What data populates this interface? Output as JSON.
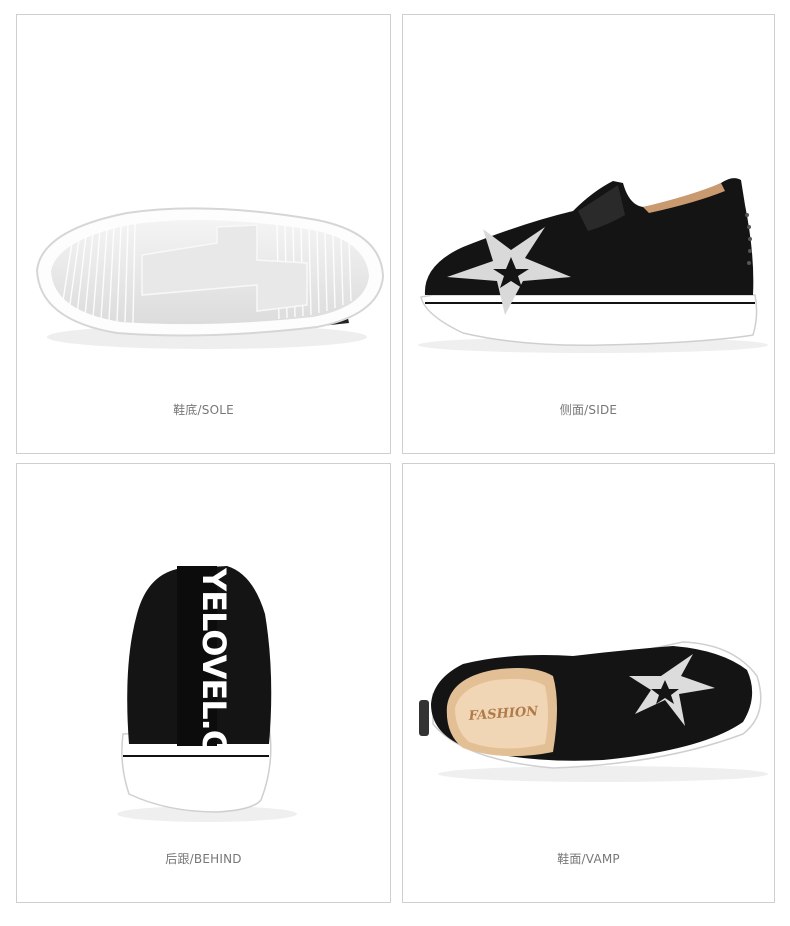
{
  "panels": [
    {
      "caption": "鞋底/SOLE",
      "view": "sole"
    },
    {
      "caption": "侧面/SIDE",
      "view": "side"
    },
    {
      "caption": "后跟/BEHIND",
      "view": "behind"
    },
    {
      "caption": "鞋面/VAMP",
      "view": "vamp"
    }
  ],
  "heel_text": "YELOVEL.C",
  "insole_text": "FASHION",
  "colors": {
    "upper": "#111111",
    "sole": "#ffffff",
    "star": "#d9d9d9",
    "border": "#cfcfcf",
    "caption": "#777777"
  }
}
